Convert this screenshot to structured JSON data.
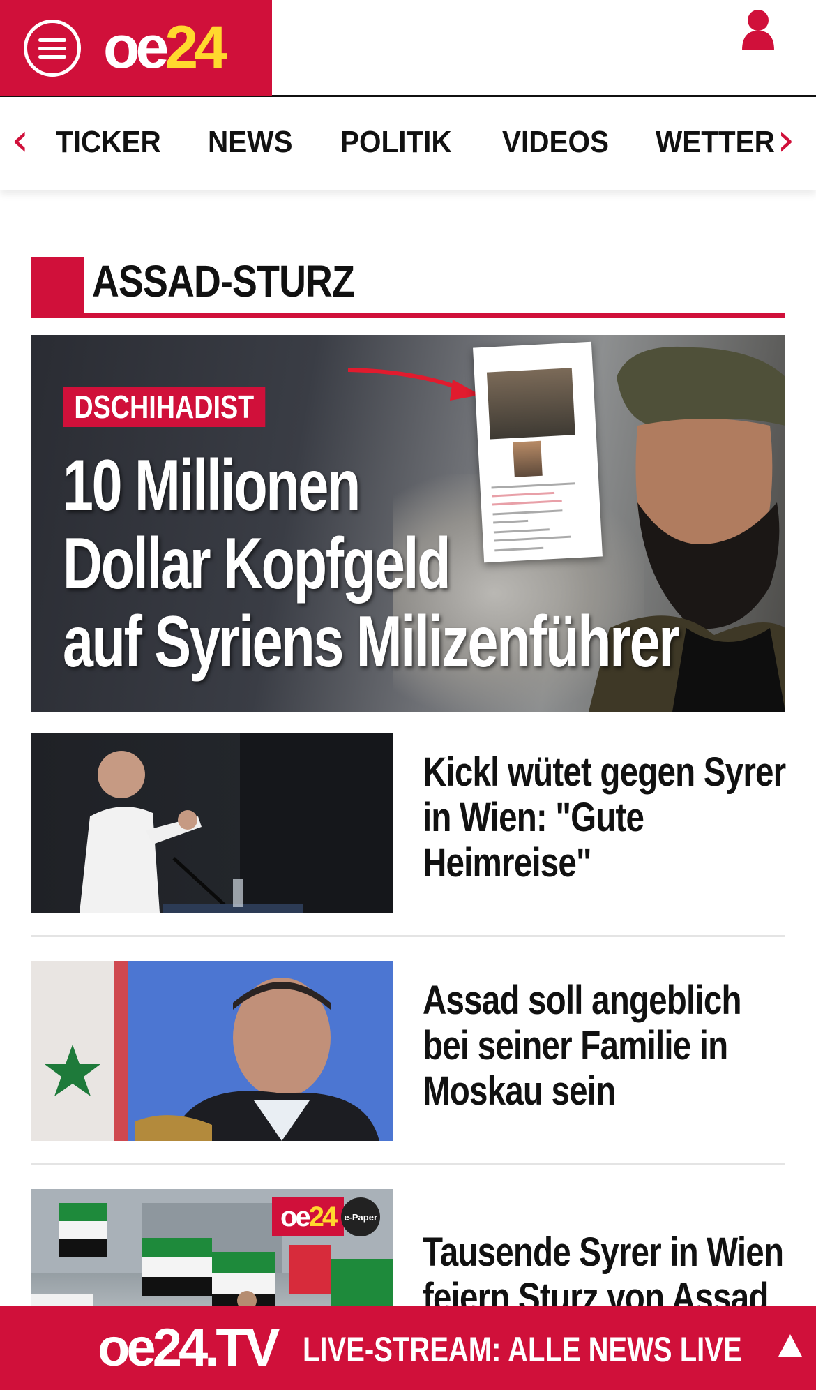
{
  "header": {
    "logo_oe": "oe",
    "logo_num": "24",
    "menu_icon": "hamburger-menu-icon",
    "user_icon": "user-icon"
  },
  "nav": {
    "items": [
      "TICKER",
      "NEWS",
      "POLITIK",
      "VIDEOS",
      "WETTER"
    ],
    "prev_icon": "chevron-left-icon",
    "next_icon": "chevron-right-icon"
  },
  "section": {
    "title": "ASSAD-STURZ"
  },
  "hero": {
    "kicker": "DSCHIHADIST",
    "title_lines": [
      "10 Millionen",
      "Dollar Kopfgeld",
      "auf Syriens Milizenführer"
    ]
  },
  "articles": [
    {
      "headline": "Kickl wütet gegen Syrer in Wien: \"Gute Heimreise\""
    },
    {
      "headline": "Assad soll angeblich bei seiner Familie in Moskau sein"
    },
    {
      "headline": "Tausende Syrer in Wien feiern Sturz von Assad",
      "badge": {
        "oe": "oe",
        "num": "24",
        "epaper": "e-Paper"
      }
    }
  ],
  "tvbar": {
    "logo": "oe24.TV",
    "text": "LIVE-STREAM:  ALLE NEWS LIVE",
    "up_icon": "triangle-up-icon"
  },
  "colors": {
    "brand_red": "#d0103a",
    "logo_yellow": "#ffd92e"
  }
}
